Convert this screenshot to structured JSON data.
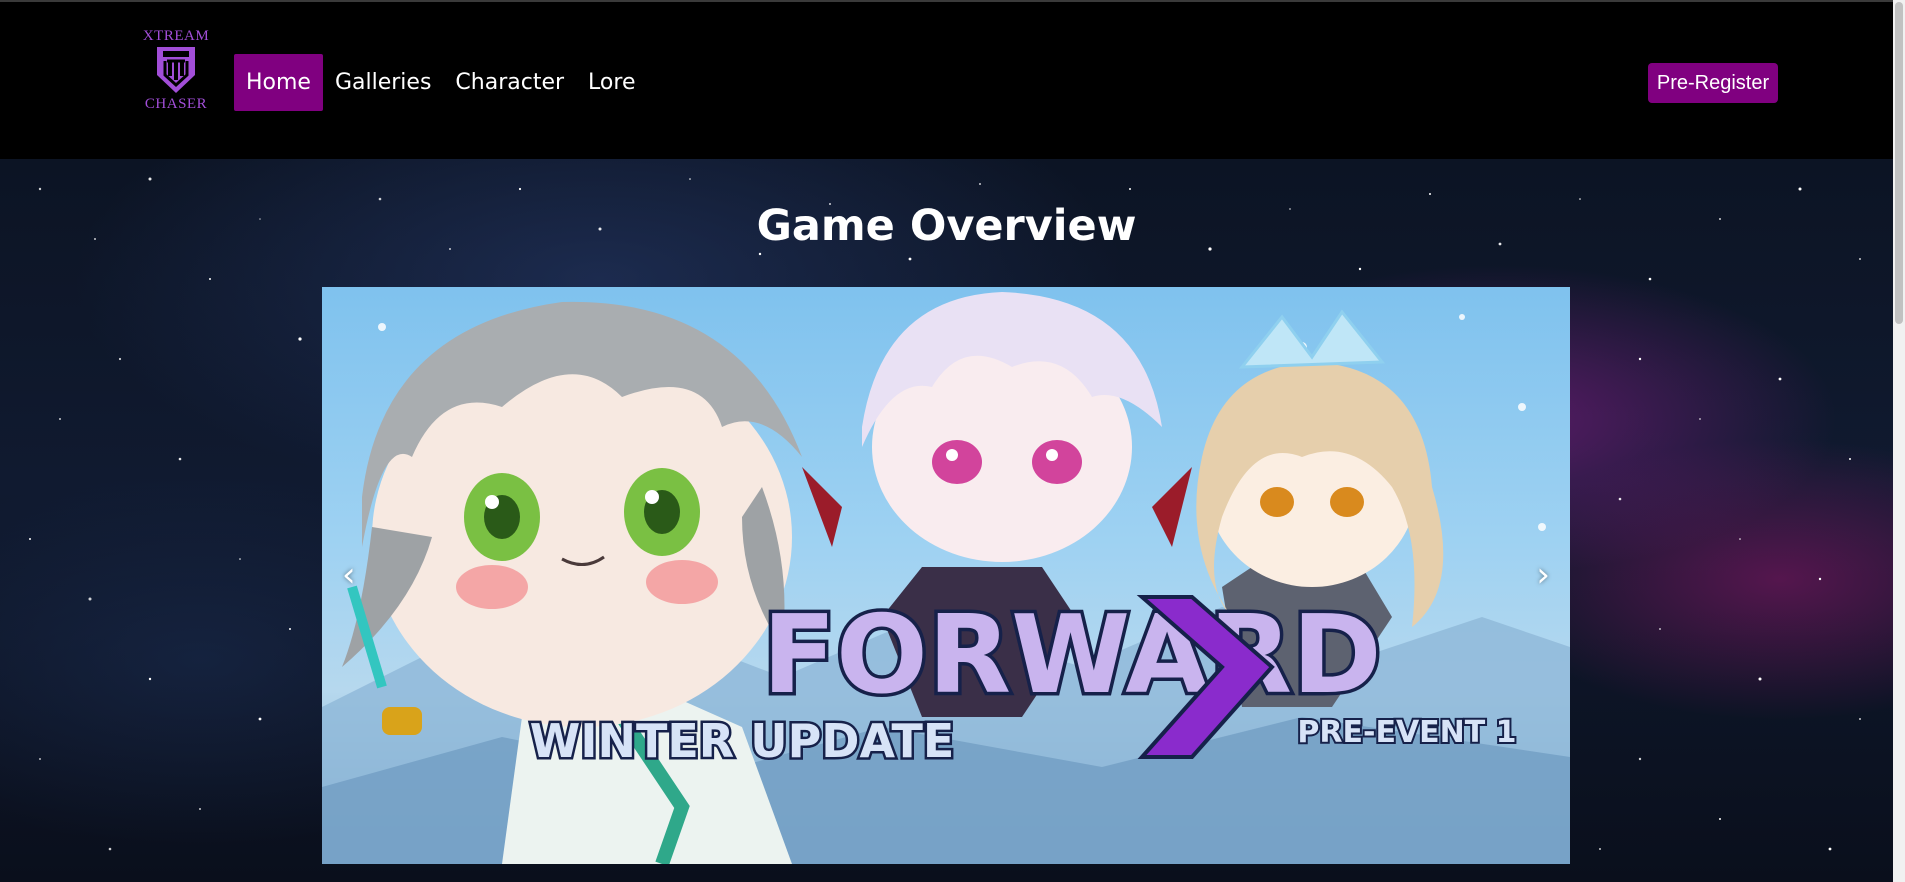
{
  "logo": {
    "top_text": "XTREAM",
    "bottom_text": "CHASER",
    "color": "#a24ed8"
  },
  "nav": {
    "items": [
      {
        "label": "Home",
        "active": true
      },
      {
        "label": "Galleries",
        "active": false
      },
      {
        "label": "Character",
        "active": false
      },
      {
        "label": "Lore",
        "active": false
      }
    ],
    "accent": "#800080"
  },
  "cta": {
    "label": "Pre-Register"
  },
  "main": {
    "title": "Game Overview"
  },
  "carousel": {
    "prev_icon": "‹",
    "next_icon": "›",
    "slide": {
      "headline": "FORWARD",
      "subline": "WINTER UPDATE",
      "tag": "PRE-EVENT 1",
      "alt": "Forward Winter Update Pre-Event 1 banner with three chibi characters"
    }
  }
}
